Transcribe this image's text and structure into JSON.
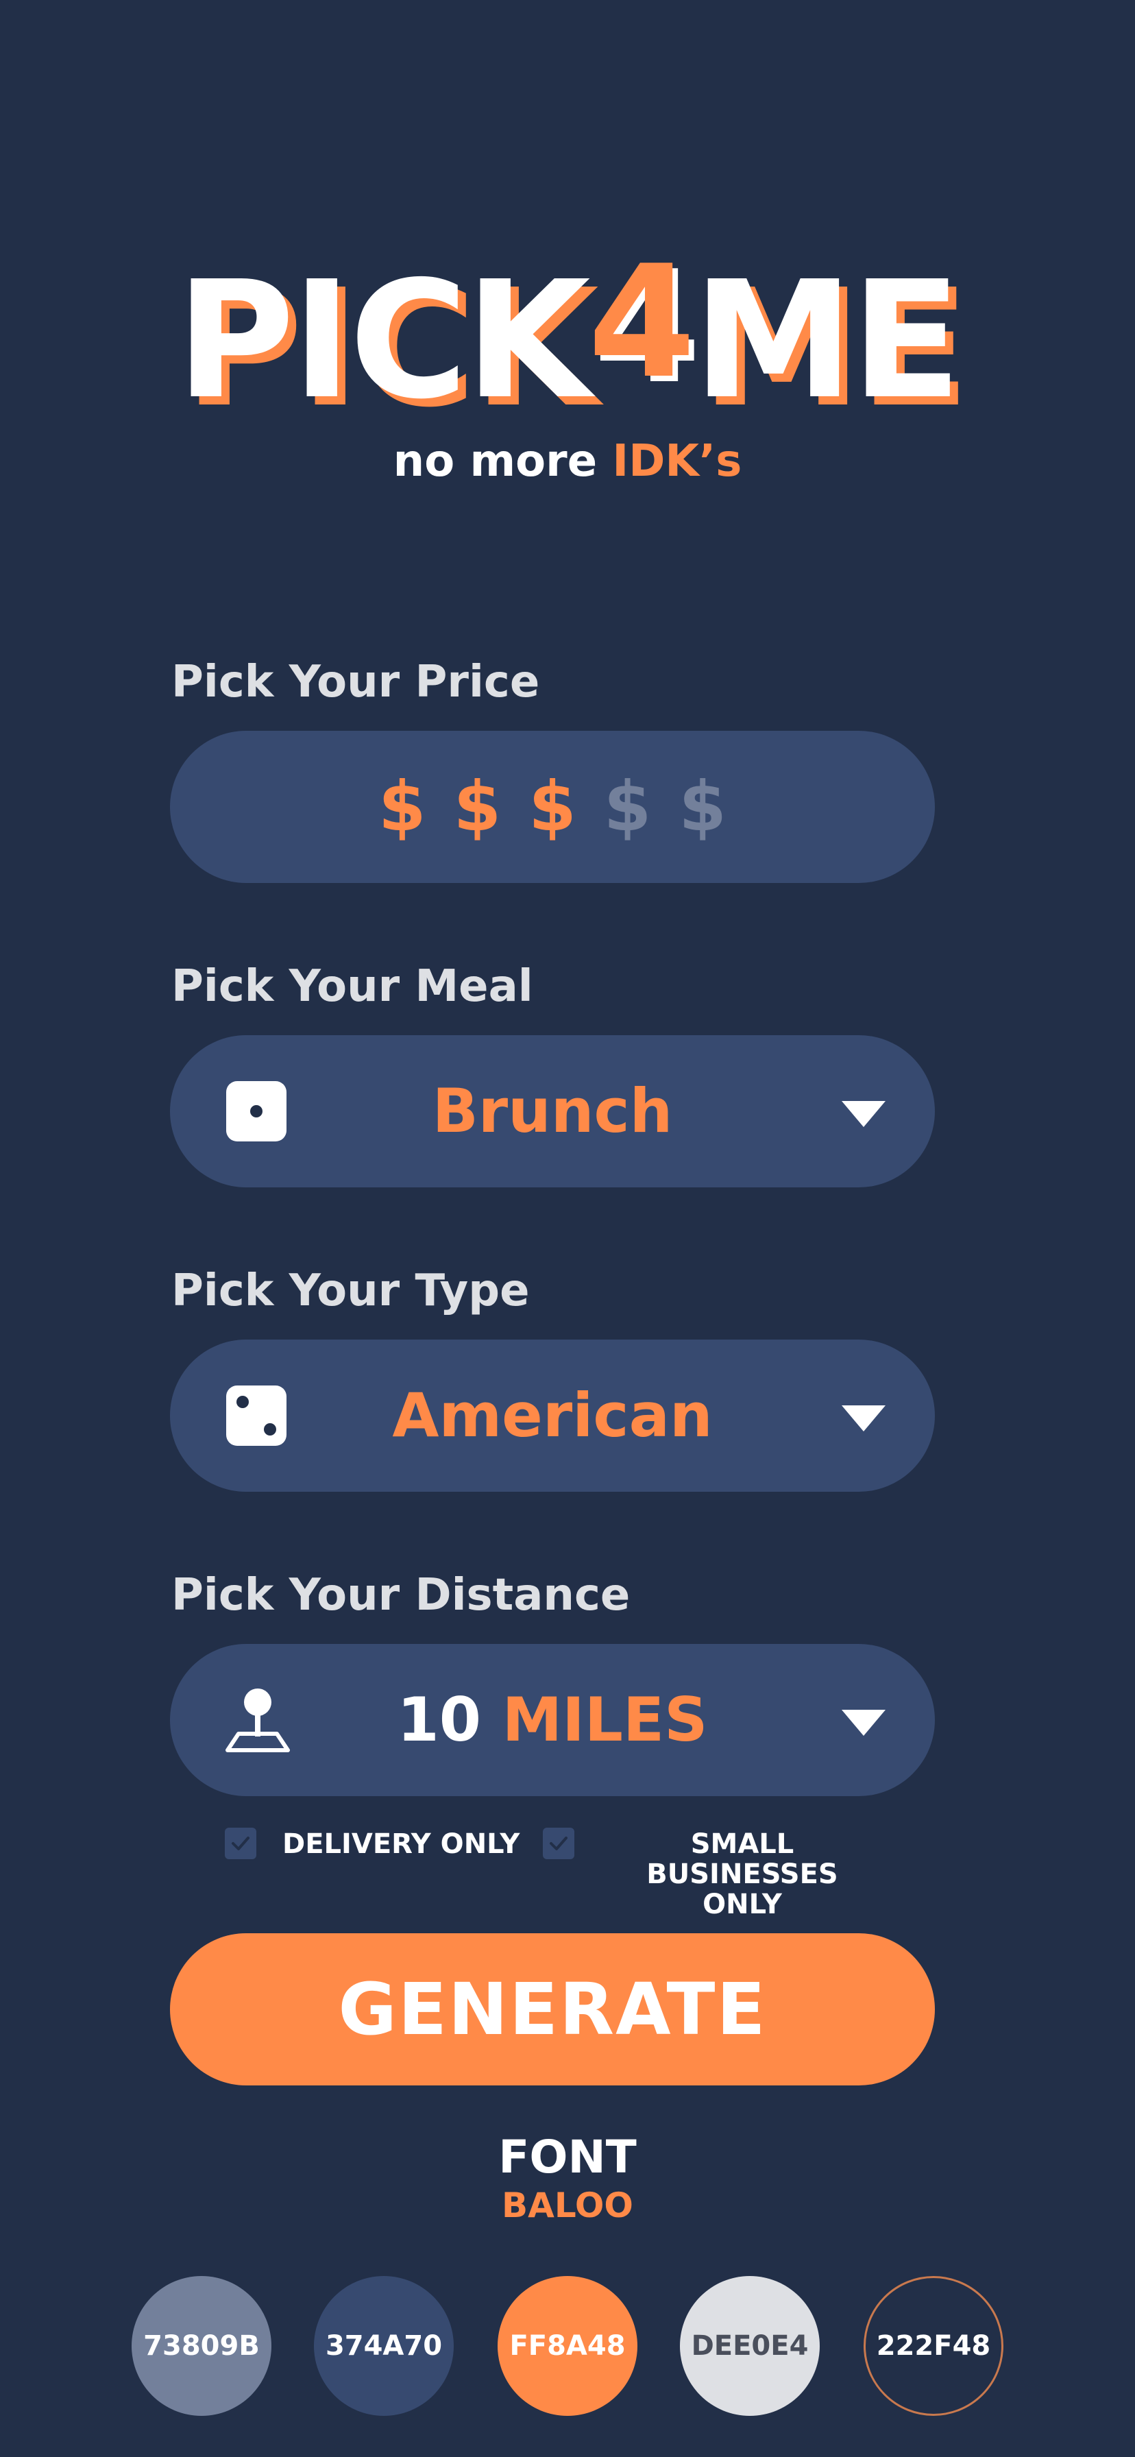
{
  "header": {
    "logo_part1": "PICK",
    "logo_part2": "4",
    "logo_part3": "ME",
    "tagline_start": "no more ",
    "tagline_accent": "IDK’s"
  },
  "price": {
    "label": "Pick Your Price",
    "symbols": [
      "$",
      "$",
      "$",
      "$",
      "$"
    ],
    "selected_level": 3,
    "max_level": 5
  },
  "meal": {
    "label": "Pick Your Meal",
    "value": "Brunch",
    "icon": "dice-one-icon"
  },
  "type": {
    "label": "Pick Your Type",
    "value": "American",
    "icon": "dice-two-icon"
  },
  "distance": {
    "label": "Pick Your Distance",
    "number": "10",
    "unit": "MILES",
    "icon": "location-pin-icon"
  },
  "options": {
    "delivery_label": "DELIVERY ONLY",
    "small_biz_label_line1": "SMALL BUSINESSES",
    "small_biz_label_line2": "ONLY"
  },
  "generate_label": "GENERATE",
  "style_guide": {
    "font_title": "FONT",
    "font_name": "BALOO",
    "swatches": [
      {
        "label": "73809B",
        "color": "#73809B",
        "text_color": "#FFFFFF"
      },
      {
        "label": "374A70",
        "color": "#374A70",
        "text_color": "#FFFFFF"
      },
      {
        "label": "FF8A48",
        "color": "#FF8A48",
        "text_color": "#FFFFFF"
      },
      {
        "label": "DEE0E4",
        "color": "#DEE0E4",
        "text_color": "#4A4F5C"
      },
      {
        "label": "222F48",
        "color": "#222F48",
        "text_color": "#FFFFFF"
      }
    ]
  }
}
